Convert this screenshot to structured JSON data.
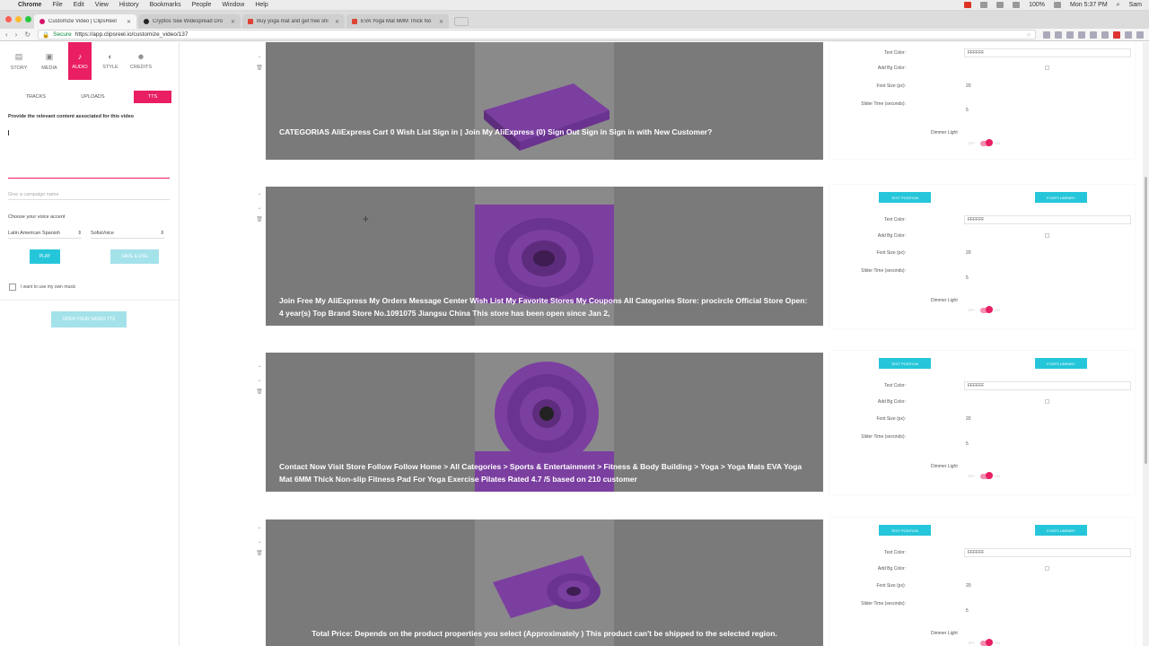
{
  "menubar": {
    "app": "Chrome",
    "items": [
      "File",
      "Edit",
      "View",
      "History",
      "Bookmarks",
      "People",
      "Window",
      "Help"
    ],
    "battery": "100%",
    "clock": "Mon 5:37 PM",
    "user": "Sam"
  },
  "tabs": [
    {
      "title": "Customize Video | ClipsReel",
      "active": true
    },
    {
      "title": "Cryptos See Widespread Dro",
      "active": false
    },
    {
      "title": "Buy yoga mat and get free shi",
      "active": false
    },
    {
      "title": "EVA Yoga Mat 6MM Thick No",
      "active": false
    }
  ],
  "address": {
    "secure_label": "Secure",
    "url": "https://app.clipsreel.io/customize_video/137"
  },
  "sidebar": {
    "nav": [
      {
        "label": "STORY",
        "icon": "story-icon",
        "glyph": "▤"
      },
      {
        "label": "MEDIA",
        "icon": "media-icon",
        "glyph": "▣"
      },
      {
        "label": "AUDIO",
        "icon": "music-note-icon",
        "glyph": "♪"
      },
      {
        "label": "STYLE",
        "icon": "palette-icon",
        "glyph": "◐"
      },
      {
        "label": "CREDITS",
        "icon": "people-icon",
        "glyph": "☻"
      }
    ],
    "subtabs": [
      "TRACKS",
      "UPLOADS",
      "TTS"
    ],
    "prompt": "Provide the relevant content associated for this video",
    "campaign_placeholder": "Give a campaign name",
    "voice_label": "Choose your voice accent",
    "accent_select": "Latin American Spanish",
    "voice_select": "SofiaVoice",
    "play_label": "PLAY",
    "save_label": "SAVE & USE",
    "own_music_label": "I want to use my own music",
    "open_saved_label": "OPEN YOUR SAVED TTS"
  },
  "slide_panel": {
    "text_position_label": "TEXT POSITION",
    "fonts_library_label": "FONTS LIBRARY",
    "text_color_label": "Text Color:",
    "add_bg_label": "Add Bg Color:",
    "font_size_label": "Font Size (px):",
    "slider_time_label": "Slider Time (seconds):",
    "dimmer_label": "Dimmer Light",
    "off_label": "OFF",
    "on_label": "ON"
  },
  "slides": [
    {
      "caption": "CATEGORIAS AliExpress Cart 0 Wish List Sign in | Join My AliExpress (0) Sign Out Sign in Sign in with New Customer?",
      "text_color": "FFFFFF",
      "font_size": "20",
      "slider_time": "5"
    },
    {
      "caption": "Join Free My AliExpress My Orders Message Center Wish List My Favorite Stores My Coupons All Categories Store: procircle Official Store Open: 4 year(s) Top Brand Store No.1091075 Jiangsu China This store has been open since Jan 2,",
      "text_color": "FFFFFF",
      "font_size": "20",
      "slider_time": "5"
    },
    {
      "caption": "Contact Now Visit Store Follow Follow Home > All Categories > Sports & Entertainment > Fitness & Body Building > Yoga > Yoga Mats EVA Yoga Mat 6MM Thick Non-slip Fitness Pad For Yoga Exercise Pilates Rated 4.7 /5 based on 210 customer",
      "text_color": "FFFFFF",
      "font_size": "20",
      "slider_time": "5"
    },
    {
      "caption": "Total Price: Depends on the product properties you select (Approximately ) This product can't be shipped to the selected region.",
      "text_color": "FFFFFF",
      "font_size": "20",
      "slider_time": "5"
    }
  ],
  "colors": {
    "accent": "#e91e63",
    "cyan": "#26c6da",
    "mat": "#7b3fa0"
  }
}
